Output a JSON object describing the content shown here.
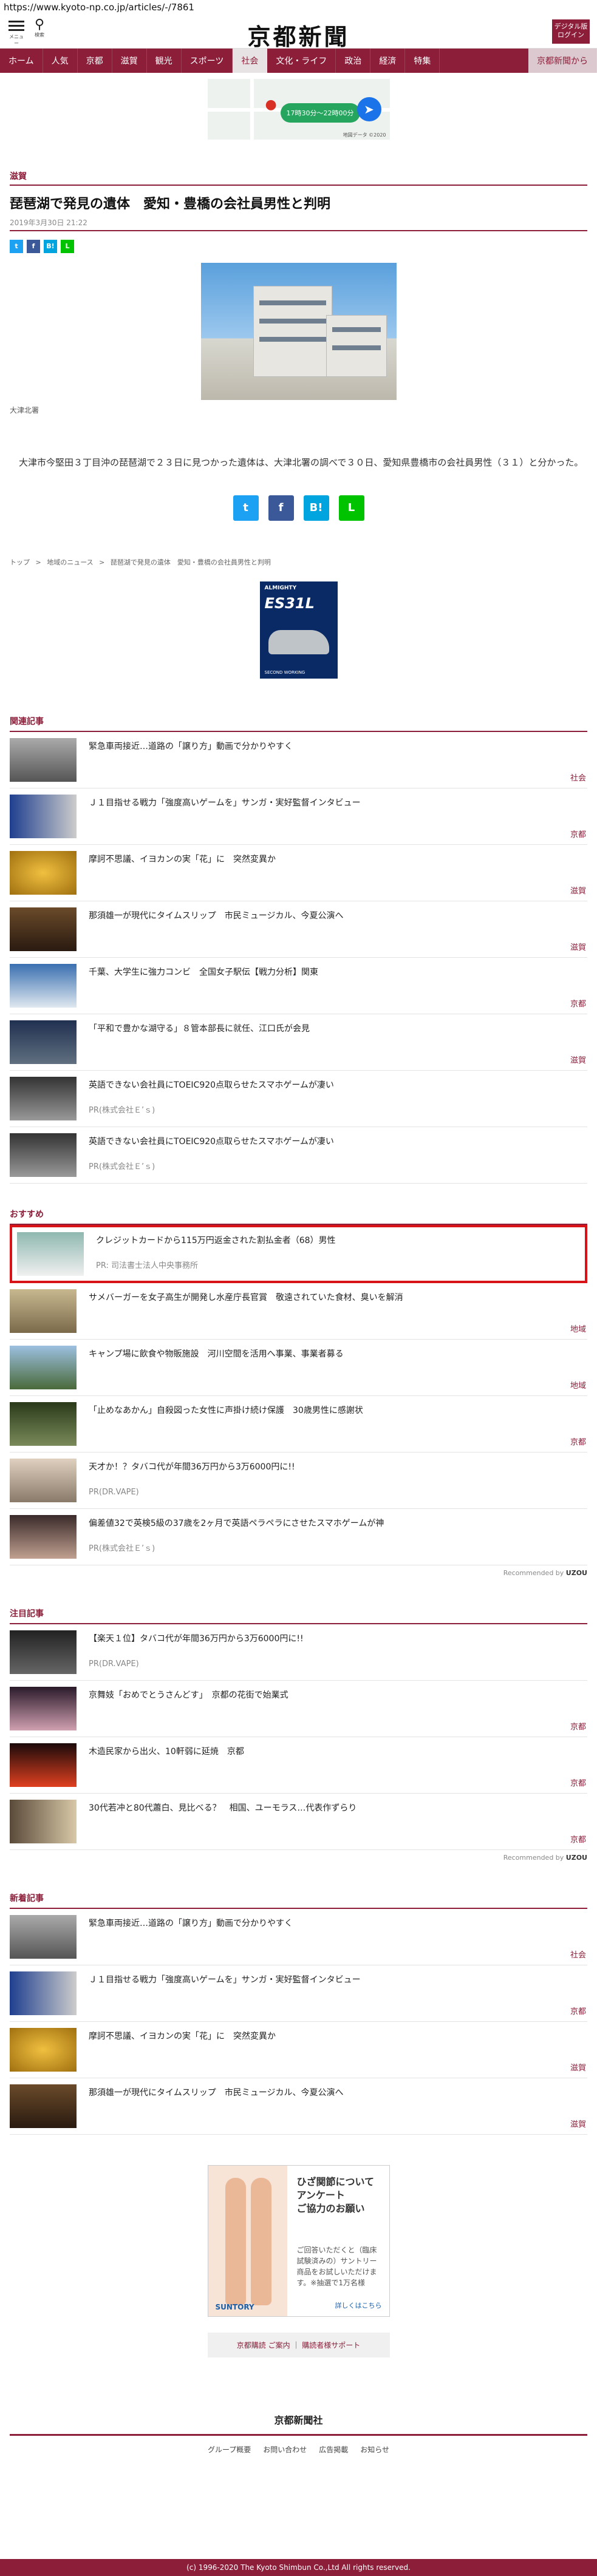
{
  "browser": {
    "url": "https://www.kyoto-np.co.jp/articles/-/7861"
  },
  "header": {
    "menu_label": "メニュー",
    "search_label": "検索",
    "logo": "京都新聞",
    "login_line1": "デジタル版",
    "login_line2": "ログイン"
  },
  "nav": [
    {
      "label": "ホーム"
    },
    {
      "label": "人気"
    },
    {
      "label": "京都"
    },
    {
      "label": "滋賀"
    },
    {
      "label": "観光"
    },
    {
      "label": "スポーツ"
    },
    {
      "label": "社会"
    },
    {
      "label": "文化・ライフ"
    },
    {
      "label": "政治"
    },
    {
      "label": "経済"
    },
    {
      "label": "特集"
    },
    {
      "label": "京都新聞から"
    }
  ],
  "ad_top": {
    "pill": "17時30分～22時00分",
    "credit": "地図データ ©2020"
  },
  "article": {
    "category": "滋賀",
    "headline": "琵琶湖で発見の遺体　愛知・豊橋の会社員男性と判明",
    "date": "2019年3月30日 21:22",
    "photo_caption": "大津北署",
    "body": "　大津市今堅田３丁目沖の琵琶湖で２３日に見つかった遺体は、大津北署の調べで３０日、愛知県豊橋市の会社員男性（３１）と分かった。"
  },
  "share": {
    "twitter": "t",
    "facebook": "f",
    "hatena": "B!",
    "line": "L"
  },
  "breadcrumb": {
    "home": "トップ",
    "sep": ">",
    "section": "地域のニュース",
    "current": "琵琶湖で発見の遺体　愛知・豊橋の会社員男性と判明"
  },
  "ad_shoe": {
    "brand": "ALMIGHTY",
    "model": "ES31L",
    "tag": "SECOND WORKING"
  },
  "related": {
    "title": "関連記事",
    "items": [
      {
        "title": "緊急車両接近…道路の「譲り方」動画で分かりやすく",
        "sub": "",
        "loc": "社会"
      },
      {
        "title": "Ｊ１目指せる戦力「強度高いゲームを」サンガ・実好監督インタビュー",
        "sub": "",
        "loc": "京都"
      },
      {
        "title": "摩訶不思議、イヨカンの実「花」に　突然変異か",
        "sub": "",
        "loc": "滋賀"
      },
      {
        "title": "那須雄一が現代にタイムスリップ　市民ミュージカル、今夏公演へ",
        "sub": "",
        "loc": "滋賀"
      },
      {
        "title": "千葉、大学生に強力コンビ　全国女子駅伝【戦力分析】関東",
        "sub": "",
        "loc": "京都"
      },
      {
        "title": "「平和で豊かな湖守る」８管本部長に就任、江口氏が会見",
        "sub": "",
        "loc": "滋賀"
      },
      {
        "title": "英語できない会社員にTOEIC920点取らせたスマホゲームが凄い",
        "sub": "PR(株式会社Ｅ’ｓ)",
        "loc": ""
      },
      {
        "title": "英語できない会社員にTOEIC920点取らせたスマホゲームが凄い",
        "sub": "PR(株式会社Ｅ’ｓ)",
        "loc": ""
      }
    ]
  },
  "recommend": {
    "title": "おすすめ",
    "items": [
      {
        "title": "クレジットカードから115万円返金された割払金者（68）男性",
        "sub": "PR: 司法書士法人中央事務所",
        "loc": ""
      },
      {
        "title": "サメバーガーを女子高生が開発し水産庁長官賞　敬遠されていた食材、臭いを解消",
        "sub": "",
        "loc": "地域"
      },
      {
        "title": "キャンプ場に飲食や物販施設　河川空間を活用へ事業、事業者募る",
        "sub": "",
        "loc": "地域"
      },
      {
        "title": "「止めなあかん」自殺図った女性に声掛け続け保護　30歳男性に感謝状",
        "sub": "",
        "loc": "京都"
      },
      {
        "title": "天才か！？タバコ代が年間36万円から3万6000円に!!",
        "sub": "PR(DR.VAPE)",
        "loc": ""
      },
      {
        "title": "偏差値32で英検5級の37歳を2ヶ月で英語ペラペラにさせたスマホゲームが神",
        "sub": "PR(株式会社Ｅ’ｓ)",
        "loc": ""
      }
    ],
    "recommended_by": "Recommended by",
    "brand": "UZOU"
  },
  "popular": {
    "title": "注目記事",
    "items": [
      {
        "title": "【楽天１位】タバコ代が年間36万円から3万6000円に!!",
        "sub": "PR(DR.VAPE)",
        "loc": ""
      },
      {
        "title": "京舞妓「おめでとうさんどす」　京都の花街で始業式",
        "sub": "",
        "loc": "京都"
      },
      {
        "title": "木造民家から出火、10軒弱に延焼　京都",
        "sub": "",
        "loc": "京都"
      },
      {
        "title": "30代若冲と80代蕭白、見比べる？　相国、ユーモラス…代表作ずらり",
        "sub": "",
        "loc": "京都"
      }
    ],
    "recommended_by": "Recommended by",
    "brand": "UZOU"
  },
  "latest": {
    "title": "新着記事",
    "items": [
      {
        "title": "緊急車両接近…道路の「譲り方」動画で分かりやすく",
        "sub": "",
        "loc": "社会"
      },
      {
        "title": "Ｊ１目指せる戦力「強度高いゲームを」サンガ・実好監督インタビュー",
        "sub": "",
        "loc": "京都"
      },
      {
        "title": "摩訶不思議、イヨカンの実「花」に　突然変異か",
        "sub": "",
        "loc": "滋賀"
      },
      {
        "title": "那須雄一が現代にタイムスリップ　市民ミュージカル、今夏公演へ",
        "sub": "",
        "loc": "滋賀"
      }
    ]
  },
  "ad_knee": {
    "title_line1": "ひざ関節について",
    "title_line2": "アンケート",
    "title_line3": "ご協力のお願い",
    "body": "ご回答いただくと（臨床試験済みの）サントリー商品をお試しいただけます。※抽選で1万名様",
    "cta": "詳しくはこちら",
    "brand": "SUNTORY"
  },
  "footer": {
    "links": "京都購読 ご案内 ｜ 購読者様サポート",
    "logo": "京都新聞社",
    "nav": [
      "グループ概要",
      "お問い合わせ",
      "広告掲載",
      "お知らせ"
    ],
    "copyright": "(c) 1996-2020 The Kyoto Shimbun Co.,Ltd All rights reserved."
  },
  "colors": {
    "brand": "#8c1e3a",
    "highlight": "#d81418"
  }
}
